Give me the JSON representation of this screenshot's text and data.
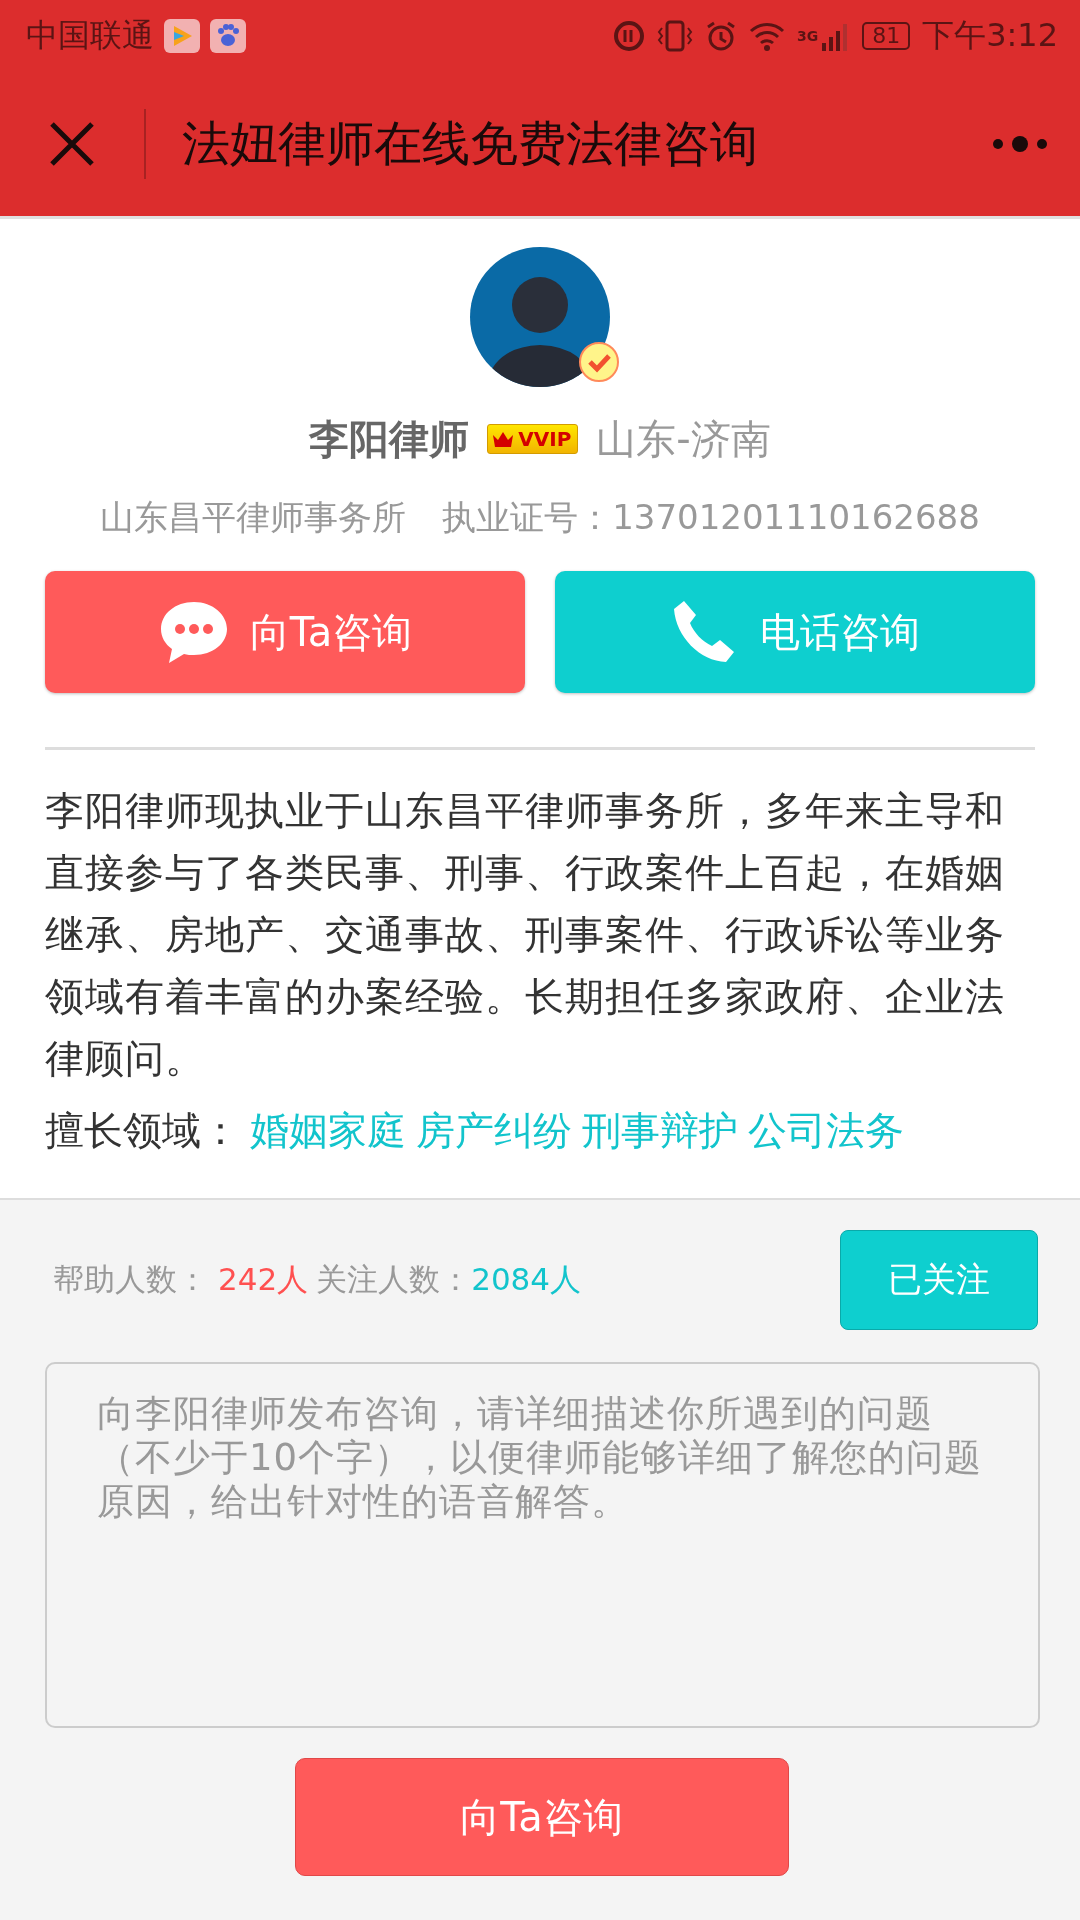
{
  "status_bar": {
    "carrier": "中国联通",
    "network": "3G",
    "battery": "81",
    "time": "下午3:12"
  },
  "nav": {
    "title": "法妞律师在线免费法律咨询"
  },
  "profile": {
    "name": "李阳律师",
    "badge": "VVIP",
    "location": "山东-济南",
    "firm": "山东昌平律师事务所",
    "license": "执业证号：13701201110162688"
  },
  "actions": [
    {
      "kind": "chat",
      "label": "向Ta咨询"
    },
    {
      "kind": "phone",
      "label": "电话咨询"
    }
  ],
  "bio": "李阳律师现执业于山东昌平律师事务所，多年来主导和直接参与了各类民事、刑事、行政案件上百起，在婚姻继承、房地产、交通事故、刑事案件、行政诉讼等业务领域有着丰富的办案经验。长期担任多家政府、企业法律顾问。",
  "specialties": {
    "label": "擅长领域：",
    "items": [
      "婚姻家庭",
      "房产纠纷",
      "刑事辩护",
      "公司法务"
    ]
  },
  "stats": {
    "helped_label": "帮助人数：",
    "helped_value": "242人",
    "followers_label": "关注人数：",
    "followers_value": "2084人"
  },
  "follow_button": {
    "label": "已关注"
  },
  "consult_box": {
    "placeholder": "向李阳律师发布咨询，请详细描述你所遇到的问题（不少于10个字），以便律师能够详细了解您的问题原因，给出针对性的语音解答。"
  },
  "submit_button": {
    "label": "向Ta咨询"
  }
}
